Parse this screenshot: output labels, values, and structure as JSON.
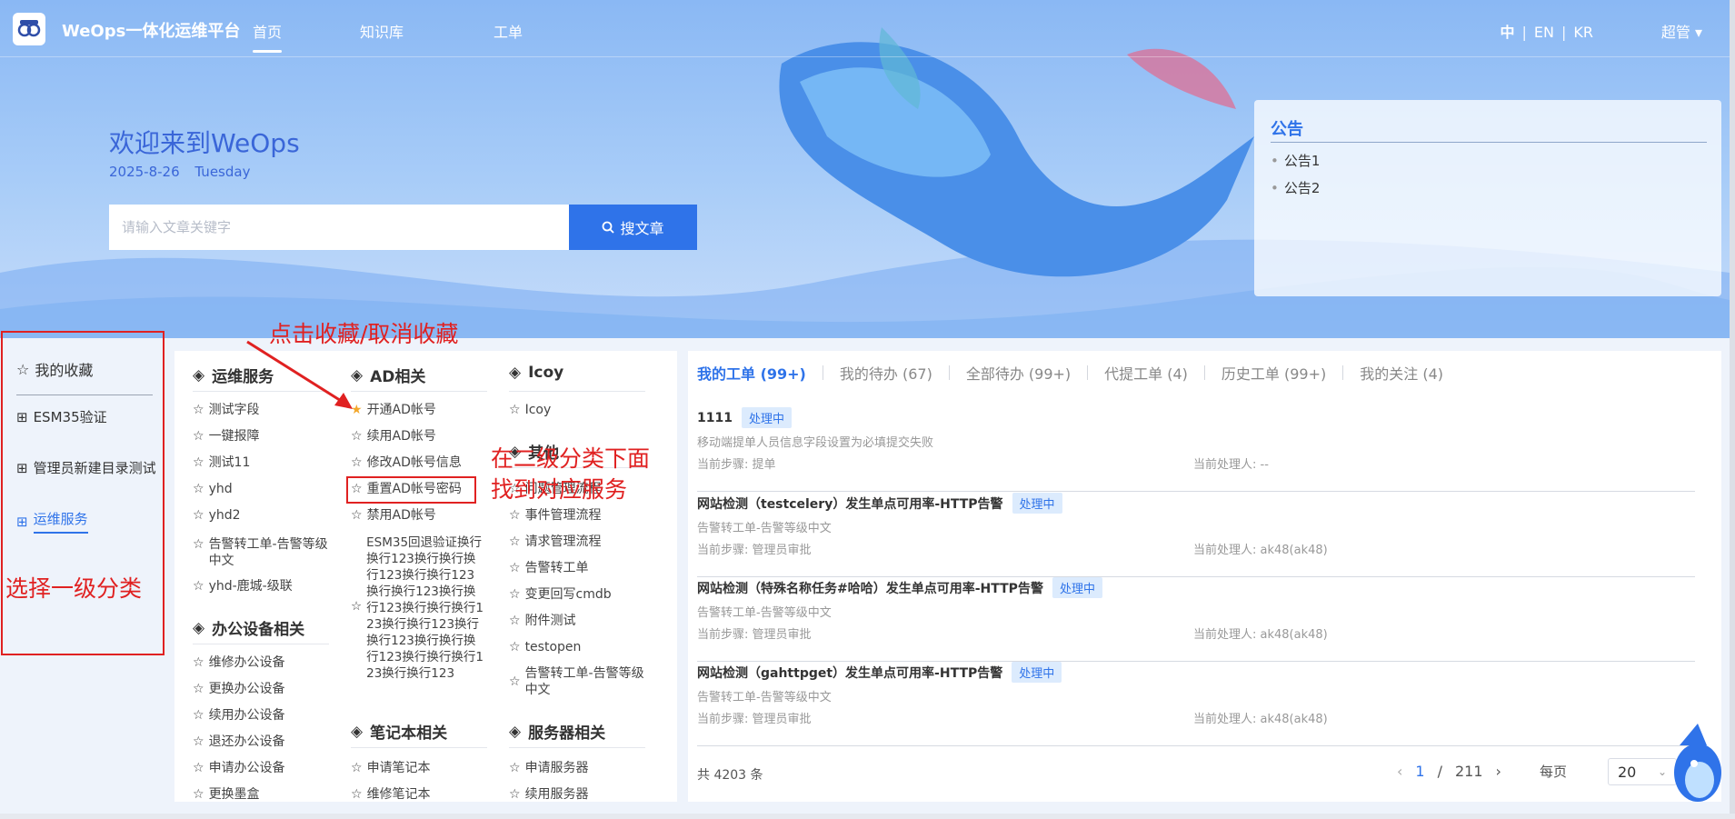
{
  "header": {
    "brand": "WeOps一体化运维平台",
    "nav": [
      "首页",
      "知识库",
      "工单"
    ],
    "lang": [
      "中",
      "EN",
      "KR"
    ],
    "user": "超管"
  },
  "hero": {
    "welcome": "欢迎来到WeOps",
    "date": "2025-8-26",
    "weekday": "Tuesday",
    "search_placeholder": "请输入文章关键字",
    "search_button": "搜文章"
  },
  "notice": {
    "title": "公告",
    "items": [
      "公告1",
      "公告2"
    ]
  },
  "categories": {
    "favorites": "我的收藏",
    "items": [
      "ESM35验证",
      "管理员新建目录测试",
      "运维服务"
    ]
  },
  "services": {
    "col1": {
      "g1": "运维服务",
      "g1_items": [
        "测试字段",
        "一键报障",
        "测试11",
        "yhd",
        "yhd2",
        "告警转工单-告警等级中文",
        "yhd-鹿城-级联"
      ],
      "g2": "办公设备相关",
      "g2_items": [
        "维修办公设备",
        "更换办公设备",
        "续用办公设备",
        "退还办公设备",
        "申请办公设备",
        "更换墨盒"
      ]
    },
    "col2": {
      "g1": "AD相关",
      "g1_items": [
        "开通AD帐号",
        "续用AD帐号",
        "修改AD帐号信息",
        "重置AD帐号密码",
        "禁用AD帐号",
        "ESM35回退验证换行换行123换行换行换行123换行换行123换行换行123换行换行123换行换行换行123换行换行123换行换行123换行换行换行123换行换行换行123换行换行123"
      ],
      "g2": "笔记本相关",
      "g2_items": [
        "申请笔记本",
        "维修笔记本"
      ]
    },
    "col3": {
      "g1": "Icoy",
      "g1_items": [
        "Icoy"
      ],
      "g2": "其他",
      "g2_items": [
        "问题管理流程",
        "事件管理流程",
        "请求管理流程",
        "告警转工单",
        "变更回写cmdb",
        "附件测试",
        "testopen",
        "告警转工单-告警等级中文"
      ],
      "g3": "服务器相关",
      "g3_items": [
        "申请服务器",
        "续用服务器"
      ]
    }
  },
  "workorders": {
    "tabs": [
      "我的工单 (99+)",
      "我的待办 (67)",
      "全部待办 (99+)",
      "代提工单 (4)",
      "历史工单 (99+)",
      "我的关注 (4)"
    ],
    "rows": [
      {
        "title": "1111",
        "badge": "处理中",
        "desc": "移动端提单人员信息字段设置为必填提交失败",
        "step": "当前步骤: 提单",
        "handler": "当前处理人: --"
      },
      {
        "title": "网站检测（testcelery）发生单点可用率-HTTP告警",
        "badge": "处理中",
        "desc": "告警转工单-告警等级中文",
        "step": "当前步骤: 管理员审批",
        "handler": "当前处理人: ak48(ak48)"
      },
      {
        "title": "网站检测（特殊名称任务#哈哈）发生单点可用率-HTTP告警",
        "badge": "处理中",
        "desc": "告警转工单-告警等级中文",
        "step": "当前步骤: 管理员审批",
        "handler": "当前处理人: ak48(ak48)"
      },
      {
        "title": "网站检测（gahttpget）发生单点可用率-HTTP告警",
        "badge": "处理中",
        "desc": "告警转工单-告警等级中文",
        "step": "当前步骤: 管理员审批",
        "handler": "当前处理人: ak48(ak48)"
      }
    ],
    "total": "共 4203 条",
    "page_current": "1",
    "page_sep": "/",
    "page_total": "211",
    "page_size_label": "每页",
    "page_size": "20"
  },
  "annotations": {
    "fav": "点击收藏/取消收藏",
    "find": "在二级分类下面\n找到对应服务",
    "select": "选择一级分类"
  },
  "colors": {
    "accent": "#2f73e9",
    "annotation": "#e02121"
  }
}
